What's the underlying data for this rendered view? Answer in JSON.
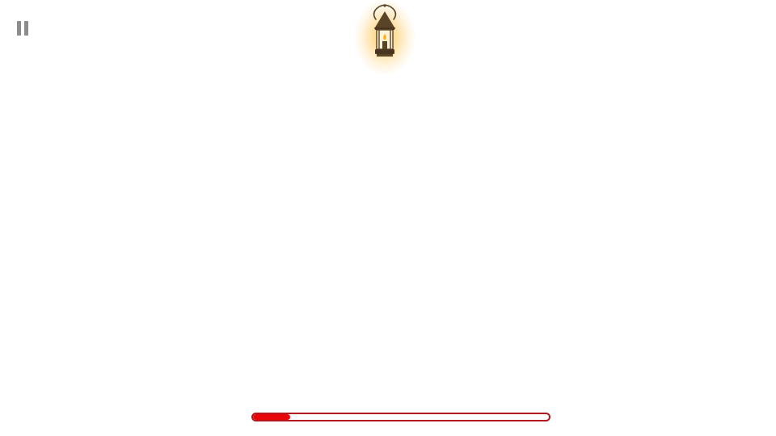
{
  "hud": {
    "pause_icon": "pause-icon",
    "lantern_icon": "lantern-icon",
    "progress": {
      "value_percent": 12.5,
      "fill_color": "#e8050a",
      "border_color": "#b3161c"
    }
  },
  "colors": {
    "background": "#ffffff",
    "pause_icon": "#8c8c8c",
    "lantern_body": "#5a4428",
    "lantern_glow": "#ffc446",
    "flame": "#ffb020"
  }
}
